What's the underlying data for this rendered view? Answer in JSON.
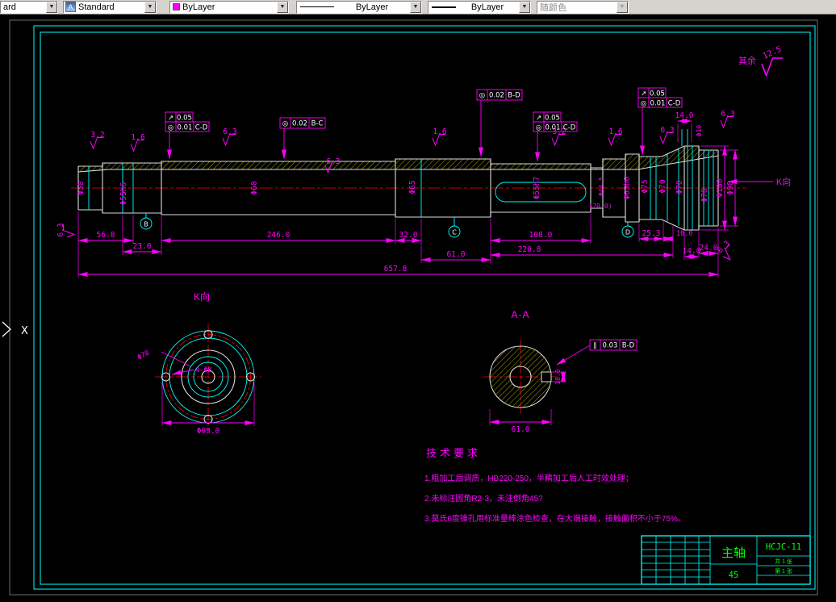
{
  "toolbar": {
    "partial_combo": "ard",
    "style": "Standard",
    "color": "ByLayer",
    "linetype": "ByLayer",
    "lineweight": "ByLayer",
    "plotstyle": "随颜色"
  },
  "axis": {
    "x": "X"
  },
  "general": {
    "surplus_label": "其余",
    "surplus_value": "12.5",
    "k_direction": "K向",
    "k_view_title": "K向",
    "aa_view_title": "A-A"
  },
  "roughness": {
    "r1": "3.2",
    "r2": "1.6",
    "r3": "6.3",
    "r4": "1.6",
    "r5": "3.2",
    "r6": "1.6",
    "r7": "6.3",
    "r8": "6.3",
    "r9": "6.3",
    "r10": "6.3",
    "r11": "6.3"
  },
  "diameters": {
    "d1": "Φ50",
    "d2": "Φ55h6",
    "d3": "Φ60",
    "d4": "Φ65",
    "d5": "Φ55h7",
    "d6": "Φ44.5",
    "d7": "Φ65h6",
    "d8": "Φ75",
    "d9": "Φ70",
    "d10": "Φ70",
    "d11": "Φ70",
    "d12": "Φ100",
    "d13": "Φ90",
    "d14": "Φ10"
  },
  "lengths": {
    "l1": "56.8",
    "l2": "23.0",
    "l3": "246.0",
    "l4": "32.0",
    "l5": "61.0",
    "l6": "108.0",
    "l7": "220.8",
    "l8": "(20.0)",
    "l9": "25.3",
    "l10": "10.0",
    "l11": "14.0",
    "l12": "24.0",
    "l13": "657.8",
    "l14": "14.0"
  },
  "gdt": {
    "f1r1s": "↗",
    "f1r1v": "0.05",
    "f1r2s": "◎",
    "f1r2v": "0.01",
    "f1r2d": "C-D",
    "f2s": "◎",
    "f2v": "0.02",
    "f2d": "B-C",
    "f3s": "◎",
    "f3v": "0.02",
    "f3d": "B-D",
    "f4r1s": "↗",
    "f4r1v": "0.05",
    "f4r2s": "◎",
    "f4r2v": "0.01",
    "f4r2d": "C-D",
    "f5r1s": "↗",
    "f5r1v": "0.05",
    "f5r2s": "◎",
    "f5r2v": "0.01",
    "f5r2d": "C-D",
    "f6s": "∥",
    "f6v": "0.03",
    "f6d": "B-D"
  },
  "datums": {
    "b": "B",
    "c": "C",
    "d": "D"
  },
  "k_view": {
    "dim1": "Φ78",
    "dim2": "4-Φ8",
    "dim3": "Φ98.0"
  },
  "aa_view": {
    "dim1": "61.0",
    "dim2": "18.0"
  },
  "tech": {
    "title": "技术要求",
    "line1": "1.粗加工后调质，HB220-250，半精加工后人工时效处理；",
    "line2": "2.未标注圆角R2-3，未注倒角45?",
    "line3": "3.莫氏6度锥孔用标准量棒涂色检查，在大端接触，接触面积不小于75%。"
  },
  "titleblock": {
    "part": "主轴",
    "code": "HCJC-11",
    "material": "45",
    "sheet1": "共 1 张",
    "sheet2": "第 1 张"
  },
  "colors": {
    "geometry": "#00ffff",
    "dimension": "#ff00ff",
    "hatch": "#a3a300",
    "centerline": "#ff0000",
    "titletext": "#00ff00"
  }
}
